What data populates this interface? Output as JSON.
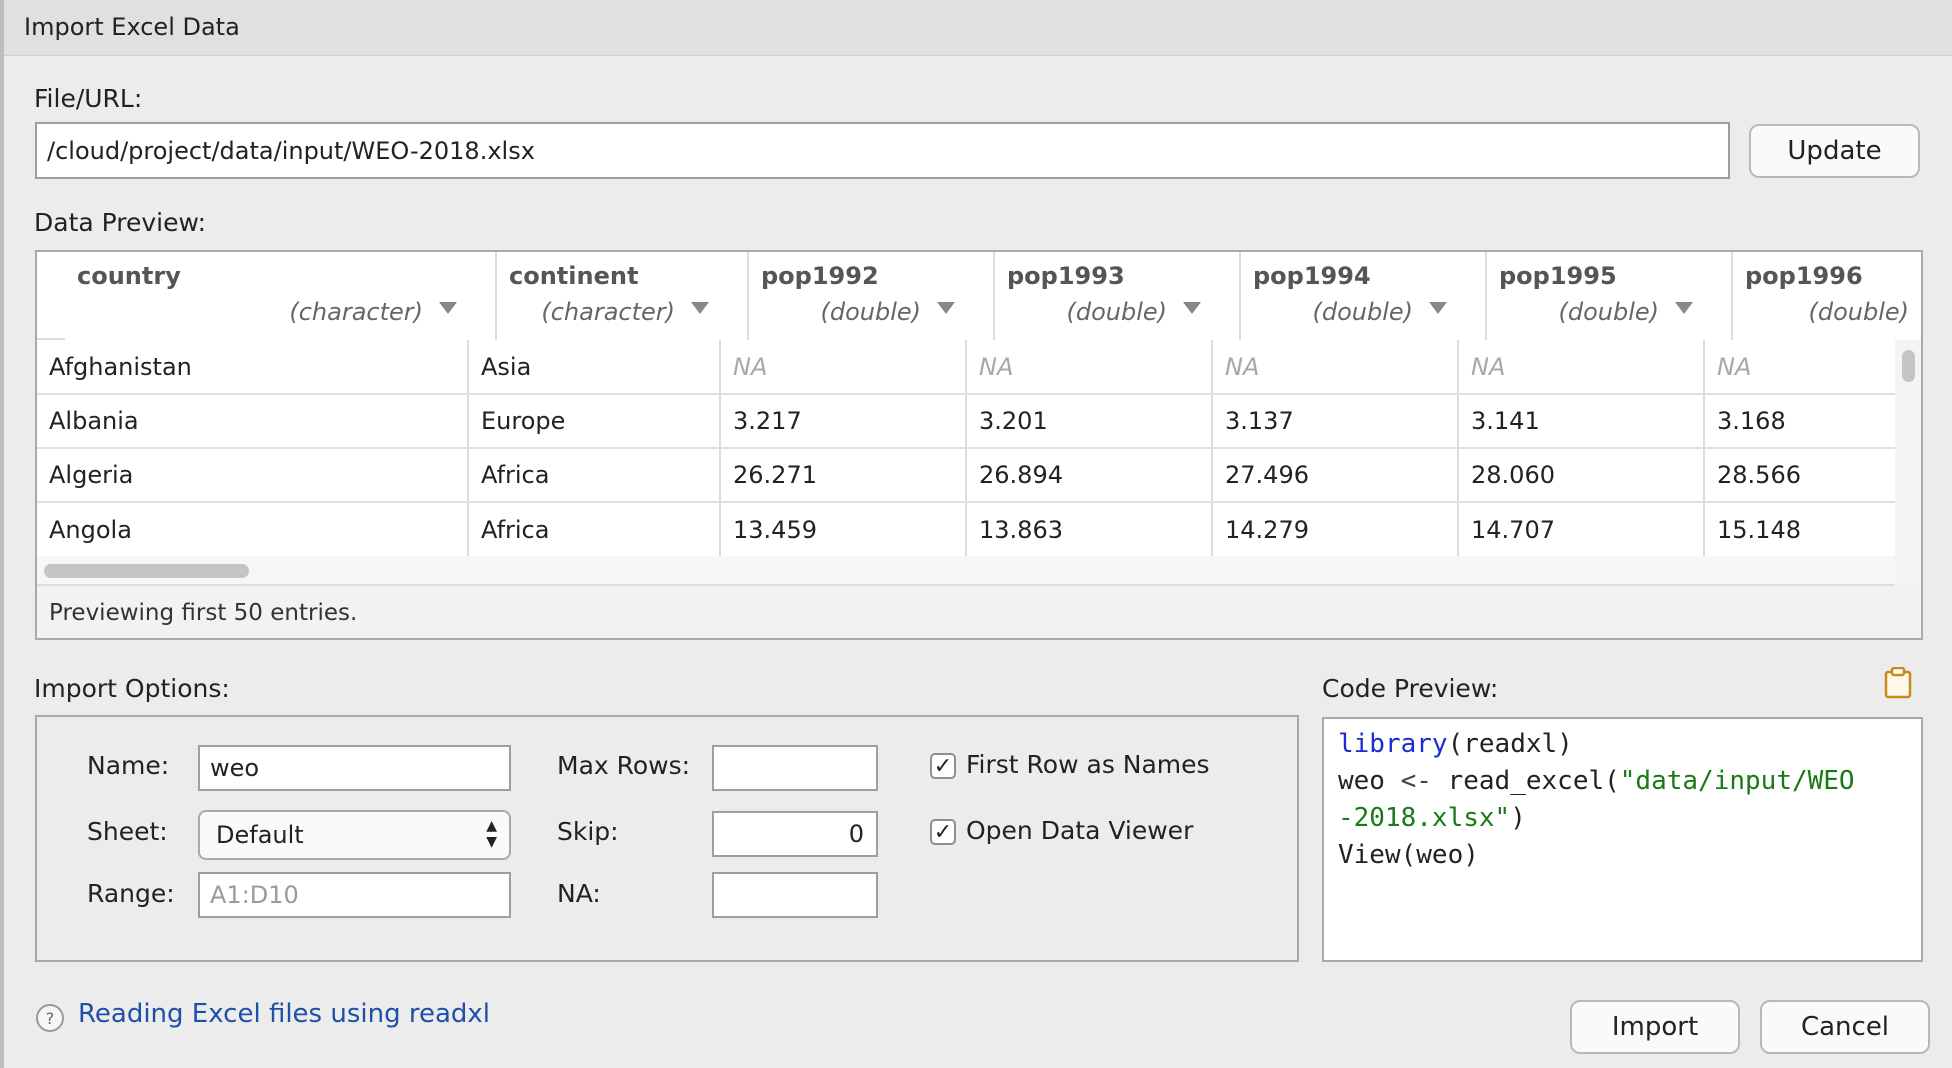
{
  "window": {
    "title": "Import Excel Data"
  },
  "file": {
    "label": "File/URL:",
    "value": "/cloud/project/data/input/WEO-2018.xlsx",
    "update_button": "Update"
  },
  "preview": {
    "label": "Data Preview:",
    "columns": [
      {
        "name": "country",
        "type": "(character)"
      },
      {
        "name": "continent",
        "type": "(character)"
      },
      {
        "name": "pop1992",
        "type": "(double)"
      },
      {
        "name": "pop1993",
        "type": "(double)"
      },
      {
        "name": "pop1994",
        "type": "(double)"
      },
      {
        "name": "pop1995",
        "type": "(double)"
      },
      {
        "name": "pop1996",
        "type": "(double)"
      }
    ],
    "rows": [
      [
        "Afghanistan",
        "Asia",
        "NA",
        "NA",
        "NA",
        "NA",
        "NA"
      ],
      [
        "Albania",
        "Europe",
        "3.217",
        "3.201",
        "3.137",
        "3.141",
        "3.168"
      ],
      [
        "Algeria",
        "Africa",
        "26.271",
        "26.894",
        "27.496",
        "28.060",
        "28.566"
      ],
      [
        "Angola",
        "Africa",
        "13.459",
        "13.863",
        "14.279",
        "14.707",
        "15.148"
      ]
    ],
    "footer": "Previewing first 50 entries."
  },
  "import_options": {
    "label": "Import Options:",
    "name_label": "Name:",
    "name_value": "weo",
    "sheet_label": "Sheet:",
    "sheet_value": "Default",
    "range_label": "Range:",
    "range_placeholder": "A1:D10",
    "maxrows_label": "Max Rows:",
    "maxrows_value": "",
    "skip_label": "Skip:",
    "skip_value": "0",
    "na_label": "NA:",
    "na_value": "",
    "first_row_label": "First Row as Names",
    "first_row_checked": true,
    "open_viewer_label": "Open Data Viewer",
    "open_viewer_checked": true
  },
  "code_preview": {
    "label": "Code Preview:",
    "line1_kw": "library",
    "line1_rest": "(readxl)",
    "line2_a": "weo ",
    "line2_op": "<-",
    "line2_b": " read_excel(",
    "line2_str": "\"data/input/WEO",
    "line3_str": "-2018.xlsx\"",
    "line3_rest": ")",
    "line4": "View(weo)"
  },
  "footer": {
    "help_link": "Reading Excel files using readxl",
    "import_button": "Import",
    "cancel_button": "Cancel"
  },
  "colors": {
    "link": "#1f4fa8",
    "keyword": "#1d2bd4",
    "string": "#187a18"
  }
}
